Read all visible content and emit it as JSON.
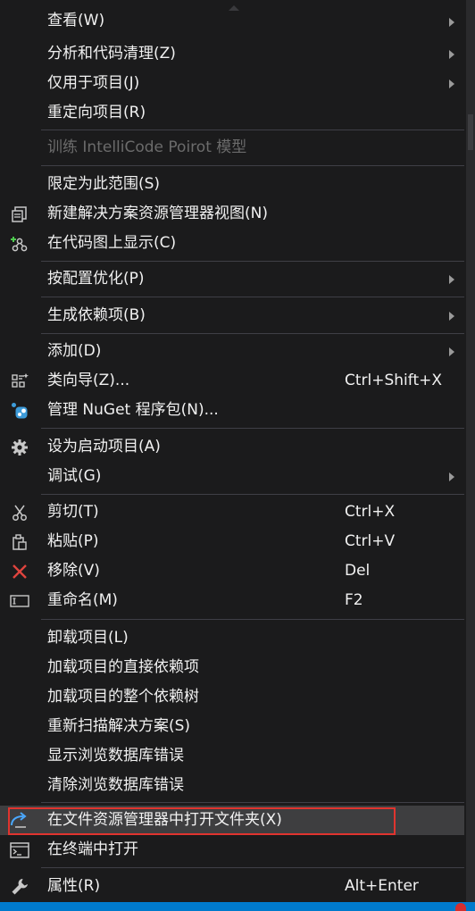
{
  "menu": {
    "items": [
      {
        "label": "查看(W)",
        "has_submenu": true
      },
      {
        "label": "分析和代码清理(Z)",
        "has_submenu": true
      },
      {
        "label": "仅用于项目(J)",
        "has_submenu": true
      },
      {
        "label": "重定向项目(R)"
      },
      {
        "label": "训练 IntelliCode Poirot 模型",
        "disabled": true
      },
      {
        "label": "限定为此范围(S)"
      },
      {
        "label": "新建解决方案资源管理器视图(N)",
        "icon": "new-view-icon"
      },
      {
        "label": "在代码图上显示(C)",
        "icon": "code-map-icon"
      },
      {
        "label": "按配置优化(P)",
        "has_submenu": true
      },
      {
        "label": "生成依赖项(B)",
        "has_submenu": true
      },
      {
        "label": "添加(D)",
        "has_submenu": true
      },
      {
        "label": "类向导(Z)...",
        "icon": "class-wizard-icon",
        "shortcut": "Ctrl+Shift+X"
      },
      {
        "label": "管理 NuGet 程序包(N)...",
        "icon": "nuget-icon"
      },
      {
        "label": "设为启动项目(A)",
        "icon": "gear-icon"
      },
      {
        "label": "调试(G)",
        "has_submenu": true
      },
      {
        "label": "剪切(T)",
        "icon": "scissors-icon",
        "shortcut": "Ctrl+X"
      },
      {
        "label": "粘贴(P)",
        "icon": "paste-icon",
        "shortcut": "Ctrl+V"
      },
      {
        "label": "移除(V)",
        "icon": "close-icon",
        "shortcut": "Del"
      },
      {
        "label": "重命名(M)",
        "icon": "rename-icon",
        "shortcut": "F2"
      },
      {
        "label": "卸载项目(L)"
      },
      {
        "label": "加载项目的直接依赖项"
      },
      {
        "label": "加载项目的整个依赖树"
      },
      {
        "label": "重新扫描解决方案(S)"
      },
      {
        "label": "显示浏览数据库错误"
      },
      {
        "label": "清除浏览数据库错误"
      },
      {
        "label": "在文件资源管理器中打开文件夹(X)",
        "icon": "open-folder-icon",
        "hovered": true
      },
      {
        "label": "在终端中打开",
        "icon": "terminal-icon"
      },
      {
        "label": "属性(R)",
        "icon": "wrench-icon",
        "shortcut": "Alt+Enter"
      }
    ]
  },
  "colors": {
    "background": "#1b1b1c",
    "text": "#f1f1f1",
    "disabled_text": "#6b6b6b",
    "hover": "#3e3e40",
    "highlight_border": "#e0342f",
    "accent_blue": "#007acc"
  }
}
